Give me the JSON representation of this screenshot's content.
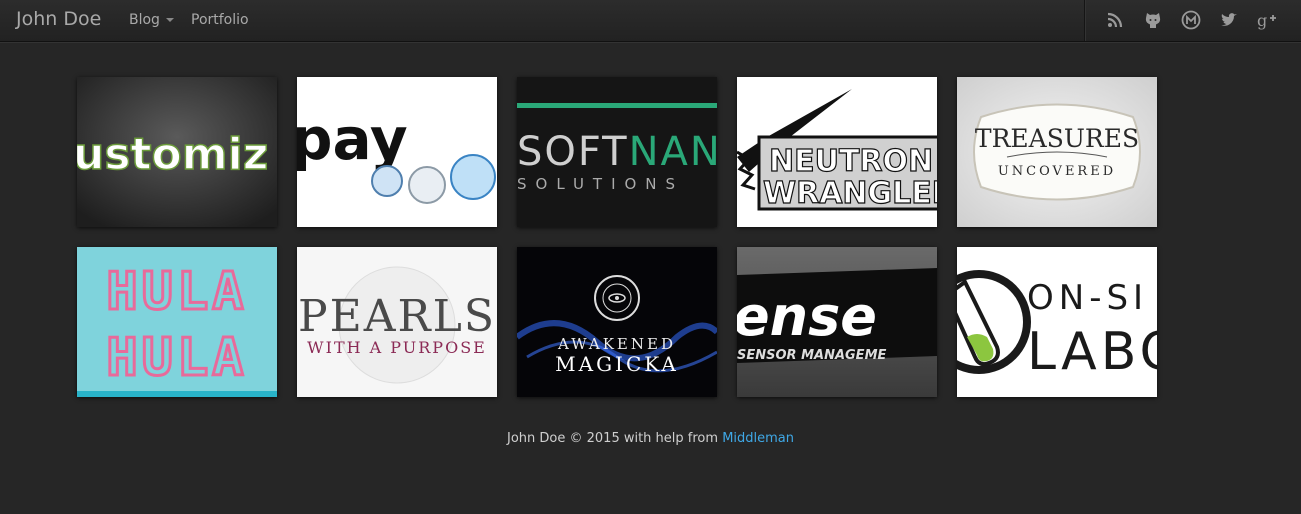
{
  "navbar": {
    "brand": "John Doe",
    "items": [
      {
        "label": "Blog",
        "has_dropdown": true
      },
      {
        "label": "Portfolio",
        "has_dropdown": false
      }
    ],
    "social_icons": [
      "rss-icon",
      "github-icon",
      "meetup-icon",
      "twitter-icon",
      "google-plus-icon"
    ]
  },
  "portfolio": {
    "tiles": [
      {
        "name": "customize",
        "text": "ustomiz"
      },
      {
        "name": "opay",
        "text": "pay"
      },
      {
        "name": "softnano",
        "text_a": "SOFT",
        "text_b": "NANO",
        "text_c": "SOLUTIONS"
      },
      {
        "name": "neutron-wrangler",
        "text_a": "NEUTRON",
        "text_b": "WRANGLER"
      },
      {
        "name": "treasures-uncovered",
        "text_a": "TREASURES",
        "text_b": "UNCOVERED"
      },
      {
        "name": "hula-hula",
        "text_a": "HULA",
        "text_b": "HULA"
      },
      {
        "name": "pearls-with-a-purpose",
        "text_a": "PEARLS",
        "text_b": "WITH A PURPOSE"
      },
      {
        "name": "awakened-magicka",
        "text_a": "AWAKENED",
        "text_b": "MAGICKA"
      },
      {
        "name": "sense",
        "text_a": "ense",
        "text_b": "SENSOR MANAGEME"
      },
      {
        "name": "on-site-labs",
        "text_a": "ON-SI",
        "text_b": "LABO"
      }
    ]
  },
  "footer": {
    "prefix": "John Doe © 2015 with help from ",
    "link": "Middleman"
  },
  "colors": {
    "background": "#262626",
    "link": "#3fa8e6",
    "softnano_green": "#2aa878",
    "hula_pink": "#e86a9a",
    "hula_cyan": "#7fd3dc",
    "on_site_green": "#8cc63f",
    "pearls_maroon": "#8b2a55"
  }
}
